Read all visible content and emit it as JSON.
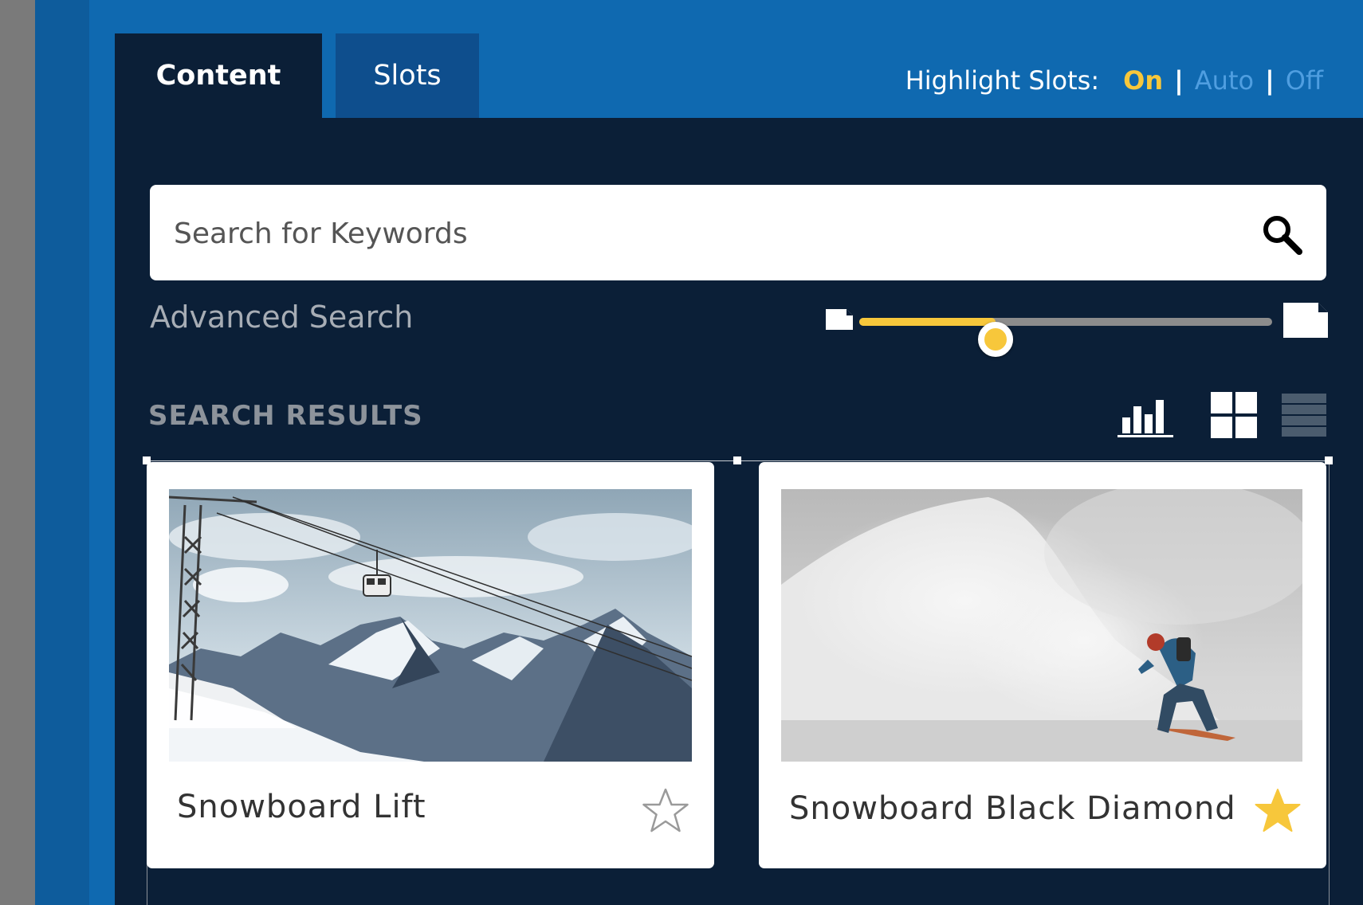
{
  "tabs": [
    {
      "label": "Content",
      "active": true
    },
    {
      "label": "Slots",
      "active": false
    }
  ],
  "highlight_slots": {
    "label": "Highlight Slots:",
    "options": [
      "On",
      "Auto",
      "Off"
    ],
    "selected": "On"
  },
  "search": {
    "placeholder": "Search for Keywords",
    "value": ""
  },
  "advanced_search_label": "Advanced Search",
  "size_slider": {
    "level": 0.33
  },
  "results": {
    "title": "SEARCH RESULTS",
    "view_modes": [
      "chart-view-icon",
      "grid-view-icon",
      "list-view-icon"
    ],
    "active_view": "grid",
    "items": [
      {
        "title": "Snowboard Lift",
        "favorite": false
      },
      {
        "title": "Snowboard Black Diamond",
        "favorite": true
      }
    ]
  },
  "colors": {
    "accent": "#f7c73b",
    "header_blue": "#0f69b0",
    "panel": "#0b1f37",
    "inactive_tab": "#0e4e8d"
  }
}
